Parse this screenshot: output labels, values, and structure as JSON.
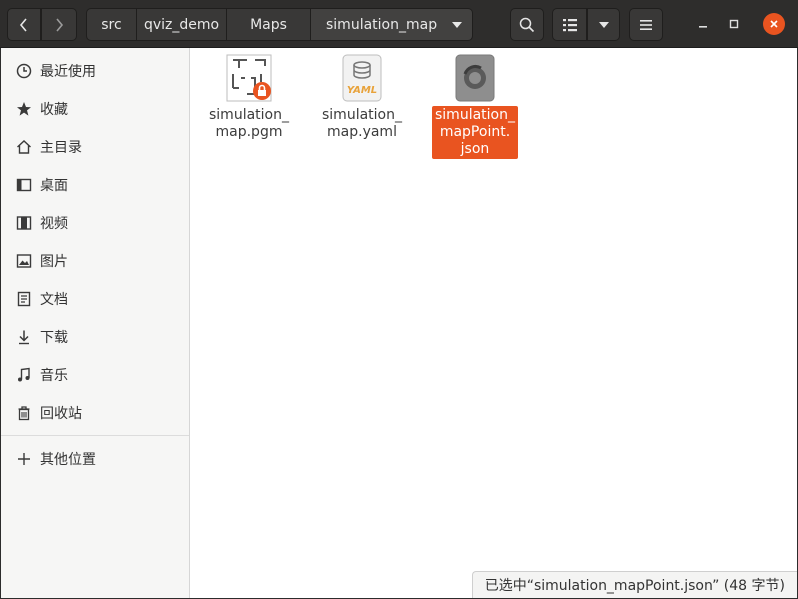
{
  "header": {
    "breadcrumbs": [
      "src",
      "qviz_demo",
      "Maps",
      "simulation_map"
    ],
    "nav_back_icon": "chevron-left-icon",
    "nav_forward_icon": "chevron-right-icon",
    "search_icon": "search-icon",
    "view_icon": "list-view-icon",
    "menu_icon": "hamburger-menu-icon",
    "close_color": "#e95420"
  },
  "sidebar": {
    "items": [
      {
        "label": "最近使用",
        "icon": "clock-icon"
      },
      {
        "label": "收藏",
        "icon": "star-icon"
      },
      {
        "label": "主目录",
        "icon": "home-icon"
      },
      {
        "label": "桌面",
        "icon": "desktop-icon"
      },
      {
        "label": "视频",
        "icon": "video-icon"
      },
      {
        "label": "图片",
        "icon": "image-icon"
      },
      {
        "label": "文档",
        "icon": "document-icon"
      },
      {
        "label": "下载",
        "icon": "download-icon"
      },
      {
        "label": "音乐",
        "icon": "music-icon"
      },
      {
        "label": "回收站",
        "icon": "trash-icon"
      }
    ],
    "other_locations": {
      "label": "其他位置",
      "icon": "plus-icon"
    }
  },
  "files": [
    {
      "name_line1": "simulation_",
      "name_line2": "map.pgm",
      "name_line3": "",
      "icon": "image-file-icon",
      "badge": "lock-icon",
      "selected": false
    },
    {
      "name_line1": "simulation_",
      "name_line2": "map.yaml",
      "name_line3": "",
      "icon": "yaml-file-icon",
      "icon_text": "YAML",
      "selected": false
    },
    {
      "name_line1": "simulation_",
      "name_line2": "mapPoint.",
      "name_line3": "json",
      "icon": "json-file-icon",
      "selected": true
    }
  ],
  "accent": "#e95420",
  "status": {
    "text": "已选中“simulation_mapPoint.json” (48 字节)"
  }
}
